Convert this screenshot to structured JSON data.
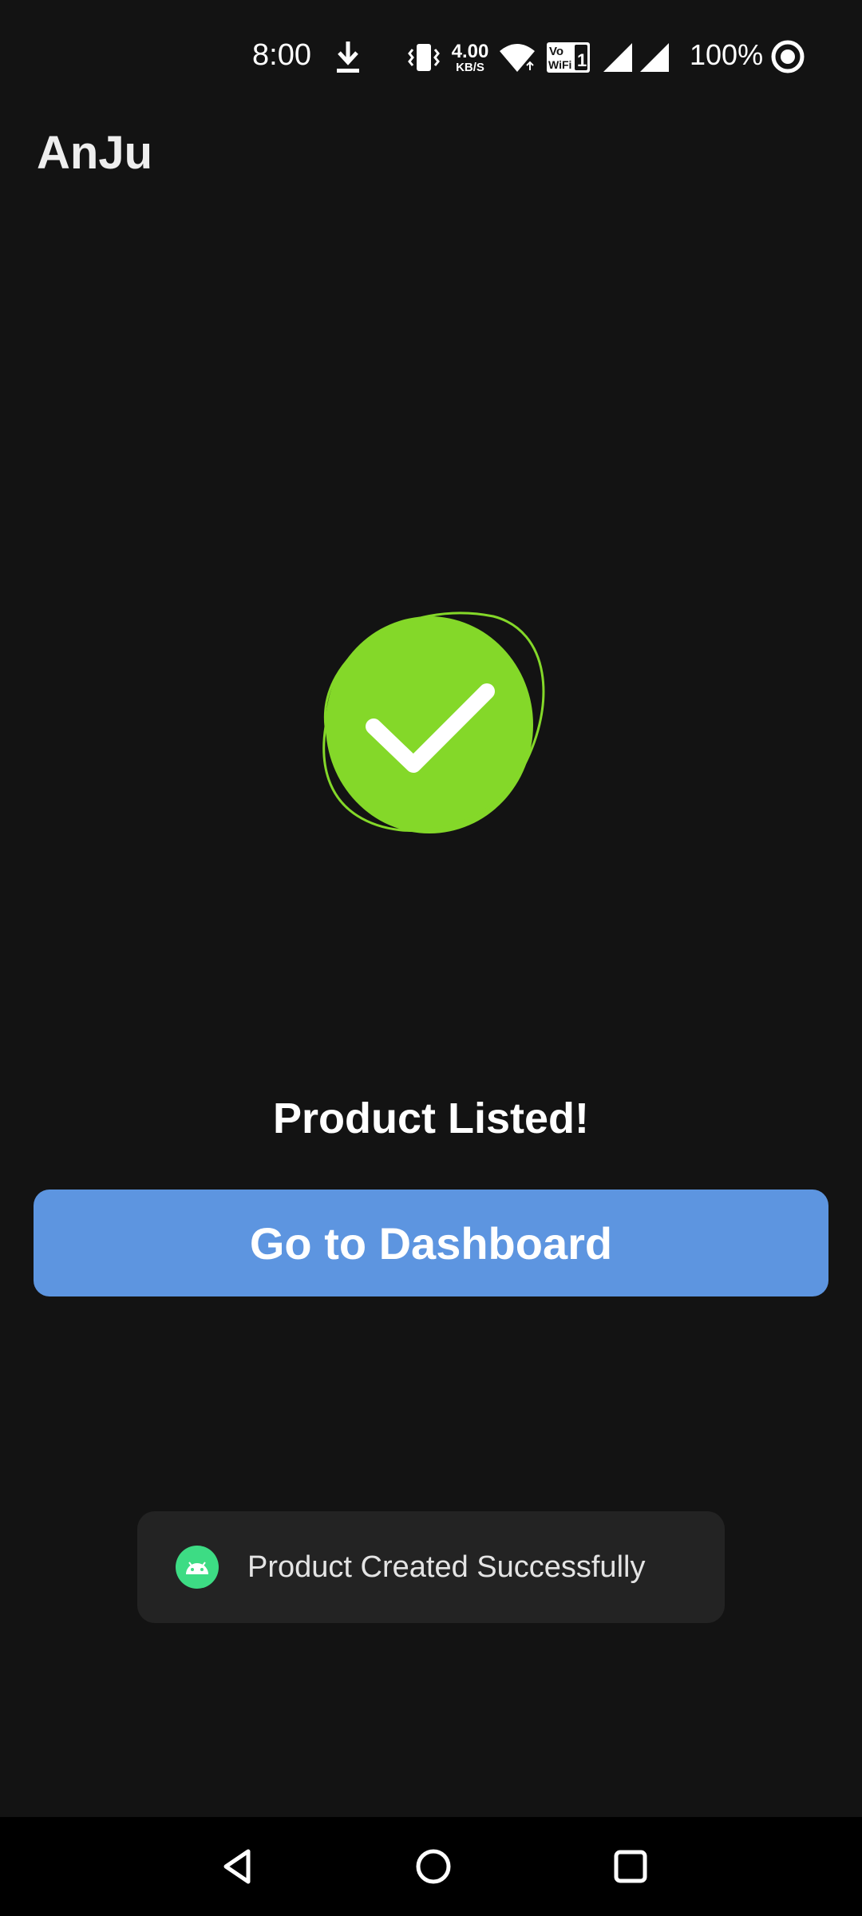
{
  "status_bar": {
    "time": "8:00",
    "net_speed_value": "4.00",
    "net_speed_unit": "KB/S",
    "vowifi_top": "Vo",
    "vowifi_bottom": "WiFi",
    "vowifi_sim": "1",
    "battery_percent": "100%",
    "icons": [
      "download-icon",
      "vibrate-icon",
      "wifi-icon",
      "vowifi-icon",
      "signal-icon",
      "signal-icon",
      "ring-icon"
    ]
  },
  "app_bar": {
    "title": "AnJu"
  },
  "main": {
    "success_icon": "check-circle-icon",
    "headline": "Product Listed!",
    "button_label": "Go to Dashboard"
  },
  "toast": {
    "icon": "android-icon",
    "message": "Product Created Successfully"
  },
  "nav_bar": {
    "icons": [
      "back-icon",
      "home-icon",
      "recents-icon"
    ]
  },
  "colors": {
    "background": "#131313",
    "accent_button": "#5d95e0",
    "success_green": "#84d829",
    "toast_background": "#232323",
    "toast_icon_green": "#3ddc84"
  }
}
